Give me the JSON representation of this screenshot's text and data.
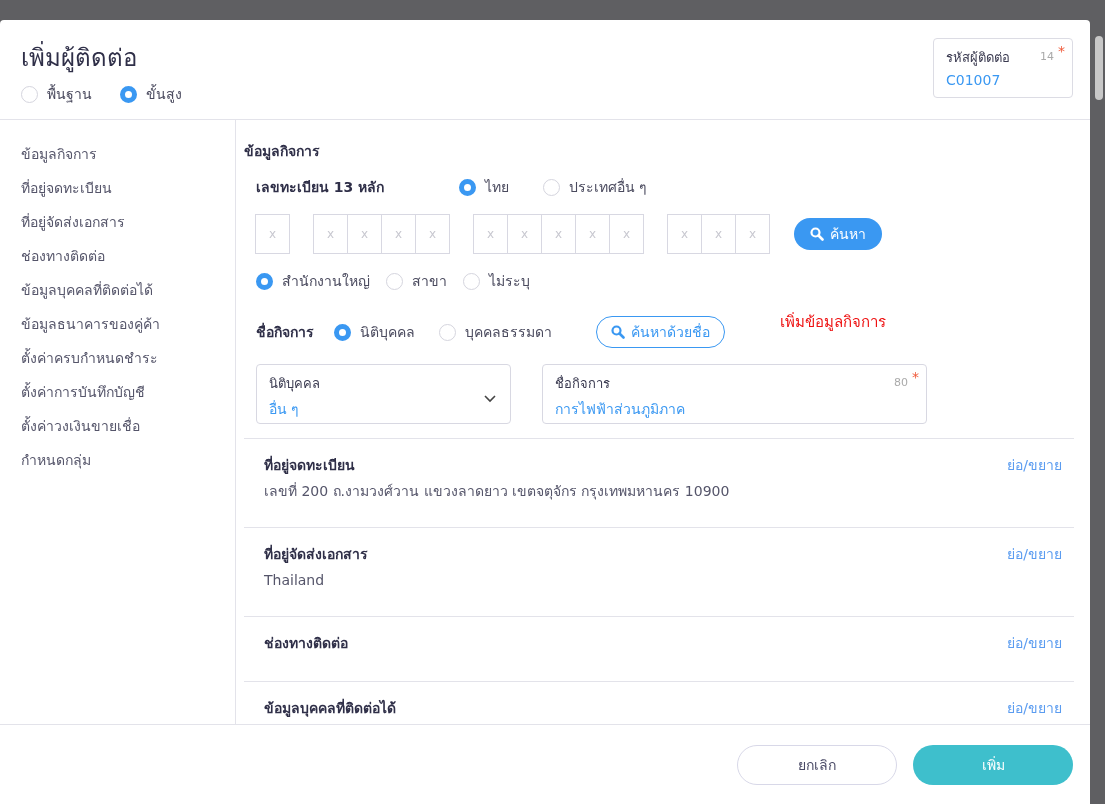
{
  "header": {
    "title": "เพิ่มผู้ติดต่อ",
    "modes": [
      {
        "label": "พื้นฐาน",
        "selected": false
      },
      {
        "label": "ขั้นสูง",
        "selected": true
      }
    ],
    "code_field": {
      "label": "รหัสผู้ติดต่อ",
      "counter": "14",
      "required_mark": "*",
      "value": "C01007"
    }
  },
  "sidebar": {
    "items": [
      {
        "label": "ข้อมูลกิจการ"
      },
      {
        "label": "ที่อยู่จดทะเบียน"
      },
      {
        "label": "ที่อยู่จัดส่งเอกสาร"
      },
      {
        "label": "ช่องทางติดต่อ"
      },
      {
        "label": "ข้อมูลบุคคลที่ติดต่อได้"
      },
      {
        "label": "ข้อมูลธนาคารของคู่ค้า"
      },
      {
        "label": "ตั้งค่าครบกำหนดชำระ"
      },
      {
        "label": "ตั้งค่าการบันทึกบัญชี"
      },
      {
        "label": "ตั้งค่าวงเงินขายเชื่อ"
      },
      {
        "label": "กำหนดกลุ่ม"
      }
    ]
  },
  "business": {
    "title": "ข้อมูลกิจการ",
    "reg_label": "เลขทะเบียน 13 หลัก",
    "countries": [
      {
        "label": "ไทย",
        "selected": true
      },
      {
        "label": "ประเทศอื่น ๆ",
        "selected": false
      }
    ],
    "id_groups": [
      [
        {
          "placeholder": "x"
        }
      ],
      [
        {
          "placeholder": "x"
        },
        {
          "placeholder": "x"
        },
        {
          "placeholder": "x"
        },
        {
          "placeholder": "x"
        }
      ],
      [
        {
          "placeholder": "x"
        },
        {
          "placeholder": "x"
        },
        {
          "placeholder": "x"
        },
        {
          "placeholder": "x"
        },
        {
          "placeholder": "x"
        }
      ],
      [
        {
          "placeholder": "x"
        },
        {
          "placeholder": "x"
        },
        {
          "placeholder": "x"
        }
      ]
    ],
    "search_button": "ค้นหา",
    "branches": [
      {
        "label": "สำนักงานใหญ่",
        "selected": true
      },
      {
        "label": "สาขา",
        "selected": false
      },
      {
        "label": "ไม่ระบุ",
        "selected": false
      }
    ],
    "name_label": "ชื่อกิจการ",
    "entity_types": [
      {
        "label": "นิติบุคคล",
        "selected": true
      },
      {
        "label": "บุคคลธรรมดา",
        "selected": false
      }
    ],
    "name_search_button": "ค้นหาด้วยชื่อ",
    "note": "เพิ่มข้อมูลกิจการ",
    "entity_select": {
      "label": "นิติบุคคล",
      "value": "อื่น ๆ"
    },
    "name_field": {
      "label": "ชื่อกิจการ",
      "counter": "80",
      "required_mark": "*",
      "value": "การไฟฟ้าส่วนภูมิภาค"
    }
  },
  "sections": [
    {
      "title": "ที่อยู่จดทะเบียน",
      "summary": "เลขที่ 200 ถ.งามวงศ์วาน แขวงลาดยาว เขตจตุจักร กรุงเทพมหานคร 10900",
      "toggle": "ย่อ/ขยาย"
    },
    {
      "title": "ที่อยู่จัดส่งเอกสาร",
      "summary": "Thailand",
      "toggle": "ย่อ/ขยาย"
    },
    {
      "title": "ช่องทางติดต่อ",
      "toggle": "ย่อ/ขยาย"
    },
    {
      "title": "ข้อมูลบุคคลที่ติดต่อได้",
      "toggle": "ย่อ/ขยาย"
    }
  ],
  "footer": {
    "cancel": "ยกเลิก",
    "submit": "เพิ่ม"
  }
}
